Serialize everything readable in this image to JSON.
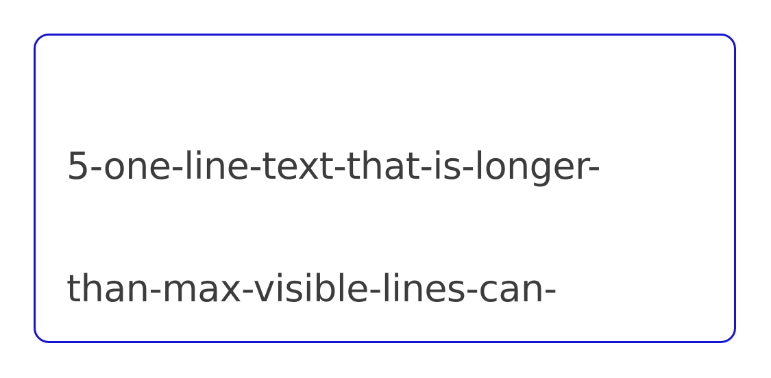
{
  "textarea": {
    "lines": [
      "5-one-line-text-that-is-longer-",
      "than-max-visible-lines-can-"
    ]
  },
  "colors": {
    "border": "#1414d2",
    "text": "#3c3c3c",
    "background": "#ffffff"
  }
}
